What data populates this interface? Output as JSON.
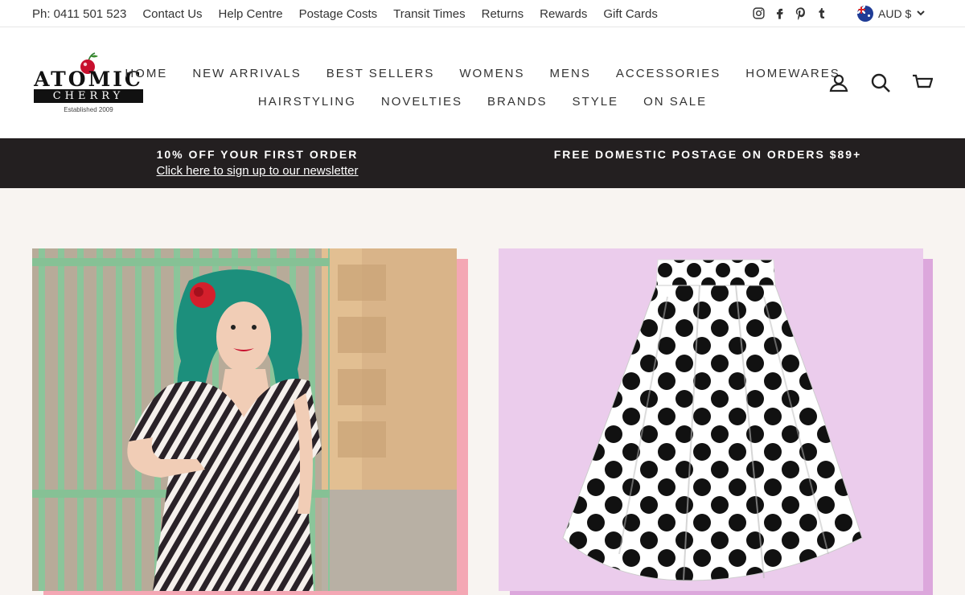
{
  "utility": {
    "links": [
      "Ph: 0411 501 523",
      "Contact Us",
      "Help Centre",
      "Postage Costs",
      "Transit Times",
      "Returns",
      "Rewards",
      "Gift Cards"
    ],
    "currency": "AUD $"
  },
  "social_icons": [
    "instagram-icon",
    "facebook-icon",
    "pinterest-icon",
    "tumblr-icon"
  ],
  "logo": {
    "word": "ATOMIC",
    "word2": "CHERRY",
    "tagline": "Established 2009"
  },
  "nav": {
    "row1": [
      "HOME",
      "NEW ARRIVALS",
      "BEST SELLERS",
      "WOMENS",
      "MENS",
      "ACCESSORIES",
      "HOMEWARES"
    ],
    "row2": [
      "HAIRSTYLING",
      "NOVELTIES",
      "BRANDS",
      "STYLE",
      "ON SALE"
    ]
  },
  "header_icons": [
    "account-icon",
    "search-icon",
    "cart-icon"
  ],
  "announcement": {
    "left_title": "10% OFF YOUR FIRST ORDER",
    "left_link": "Click here to sign up to our newsletter",
    "right_title": "FREE DOMESTIC POSTAGE ON ORDERS $89+"
  },
  "colors": {
    "announcement_bg": "#231f20",
    "page_bg": "#f8f4f1",
    "left_tile_accent": "#f4a7b4",
    "right_tile_bg": "#ebccec",
    "right_tile_accent": "#dca7dc",
    "cherry_red": "#c8102e"
  }
}
